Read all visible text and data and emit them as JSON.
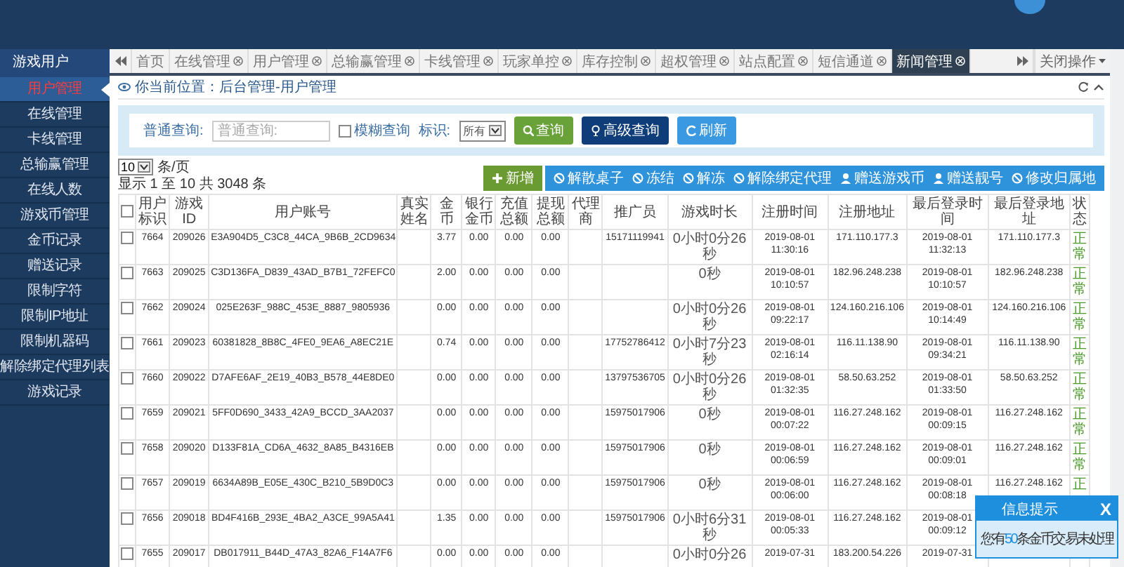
{
  "sidebar": {
    "title": "游戏用户",
    "items": [
      {
        "label": "用户管理",
        "selected": true
      },
      {
        "label": "在线管理",
        "selected": false
      },
      {
        "label": "卡线管理",
        "selected": false
      },
      {
        "label": "总输赢管理",
        "selected": false
      },
      {
        "label": "在线人数",
        "selected": false
      },
      {
        "label": "游戏币管理",
        "selected": false
      },
      {
        "label": "金币记录",
        "selected": false
      },
      {
        "label": "赠送记录",
        "selected": false
      },
      {
        "label": "限制字符",
        "selected": false
      },
      {
        "label": "限制IP地址",
        "selected": false
      },
      {
        "label": "限制机器码",
        "selected": false
      },
      {
        "label": "解除绑定代理列表",
        "selected": false
      },
      {
        "label": "游戏记录",
        "selected": false
      }
    ]
  },
  "tabs": {
    "items": [
      {
        "label": "首页",
        "closable": false,
        "selected": false
      },
      {
        "label": "在线管理",
        "closable": true,
        "selected": false
      },
      {
        "label": "用户管理",
        "closable": true,
        "selected": false
      },
      {
        "label": "总输赢管理",
        "closable": true,
        "selected": false
      },
      {
        "label": "卡线管理",
        "closable": true,
        "selected": false
      },
      {
        "label": "玩家单控",
        "closable": true,
        "selected": false
      },
      {
        "label": "库存控制",
        "closable": true,
        "selected": false
      },
      {
        "label": "超权管理",
        "closable": true,
        "selected": false
      },
      {
        "label": "站点配置",
        "closable": true,
        "selected": false
      },
      {
        "label": "短信通道",
        "closable": true,
        "selected": false
      },
      {
        "label": "新闻管理",
        "closable": true,
        "selected": true
      }
    ],
    "close_menu": "关闭操作"
  },
  "breadcrumb": "你当前位置：后台管理-用户管理",
  "search": {
    "label": "普通查询:",
    "placeholder": "普通查询:",
    "fuzzy": {
      "label": "模糊查询",
      "checked": false
    },
    "flag_label": "标识:",
    "flag_value": "所有",
    "buttons": [
      {
        "label": "查询",
        "kind": "search"
      },
      {
        "label": "高级查询",
        "kind": "advanced"
      },
      {
        "label": "刷新",
        "kind": "refresh"
      }
    ]
  },
  "paging": {
    "page_size": "10",
    "unit": "条/页",
    "summary": "显示 1 至 10 共 3048 条"
  },
  "actions": [
    {
      "label": "新增",
      "kind": "add"
    },
    {
      "label": "解散桌子",
      "kind": "ban"
    },
    {
      "label": "冻结",
      "kind": "ban"
    },
    {
      "label": "解冻",
      "kind": "ban"
    },
    {
      "label": "解除绑定代理",
      "kind": "ban"
    },
    {
      "label": "赠送游戏币",
      "kind": "user"
    },
    {
      "label": "赠送靓号",
      "kind": "user"
    },
    {
      "label": "修改归属地",
      "kind": "ban"
    }
  ],
  "table": {
    "select_all": false,
    "columns": [
      "用户标识",
      "游戏ID",
      "用户账号",
      "真实姓名",
      "金币",
      "银行金币",
      "充值总额",
      "提现总额",
      "代理商",
      "推广员",
      "游戏时长",
      "注册时间",
      "注册地址",
      "最后登录时间",
      "最后登录地址",
      "状态"
    ],
    "rows": [
      {
        "checked": false,
        "id": "7664",
        "game_id": "209026",
        "account": "E3A904D5_C3C8_44CA_9B6B_2CD9634",
        "gold": "3.77",
        "bank_gold": "0.00",
        "recharge_total": "0.00",
        "withdraw_total": "0.00",
        "promoter": "15171119941",
        "play_time": "0小时0分26秒",
        "reg_time": "2019-08-01 11:30:16",
        "reg_address": "171.110.177.3",
        "last_login_time": "2019-08-01 11:32:13",
        "last_login_address": "171.110.177.3",
        "status": "正常"
      },
      {
        "checked": false,
        "id": "7663",
        "game_id": "209025",
        "account": "C3D136FA_D839_43AD_B7B1_72FEFC0",
        "gold": "2.00",
        "bank_gold": "0.00",
        "recharge_total": "0.00",
        "withdraw_total": "0.00",
        "play_time": "0秒",
        "reg_time": "2019-08-01 10:10:57",
        "reg_address": "182.96.248.238",
        "last_login_time": "2019-08-01 10:10:57",
        "last_login_address": "182.96.248.238",
        "status": "正常"
      },
      {
        "checked": false,
        "id": "7662",
        "game_id": "209024",
        "account": "025E263F_988C_453E_8887_9805936",
        "gold": "0.00",
        "bank_gold": "0.00",
        "recharge_total": "0.00",
        "withdraw_total": "0.00",
        "play_time": "0小时0分26秒",
        "reg_time": "2019-08-01 09:22:17",
        "reg_address": "124.160.216.106",
        "last_login_time": "2019-08-01 10:14:49",
        "last_login_address": "124.160.216.106",
        "status": "正常"
      },
      {
        "checked": false,
        "id": "7661",
        "game_id": "209023",
        "account": "60381828_8B8C_4FE0_9EA6_A8EC21E",
        "gold": "0.74",
        "bank_gold": "0.00",
        "recharge_total": "0.00",
        "withdraw_total": "0.00",
        "promoter": "17752786412",
        "play_time": "0小时7分23秒",
        "reg_time": "2019-08-01 02:16:14",
        "reg_address": "116.11.138.90",
        "last_login_time": "2019-08-01 09:34:21",
        "last_login_address": "116.11.138.90",
        "status": "正常"
      },
      {
        "checked": false,
        "id": "7660",
        "game_id": "209022",
        "account": "D7AFE6AF_2E19_40B3_B578_44E8DE0",
        "gold": "0.00",
        "bank_gold": "0.00",
        "recharge_total": "0.00",
        "withdraw_total": "0.00",
        "promoter": "13797536705",
        "play_time": "0小时0分26秒",
        "reg_time": "2019-08-01 01:32:35",
        "reg_address": "58.50.63.252",
        "last_login_time": "2019-08-01 01:33:50",
        "last_login_address": "58.50.63.252",
        "status": "正常"
      },
      {
        "checked": false,
        "id": "7659",
        "game_id": "209021",
        "account": "5FF0D690_3433_42A9_BCCD_3AA2037",
        "gold": "0.00",
        "bank_gold": "0.00",
        "recharge_total": "0.00",
        "withdraw_total": "0.00",
        "promoter": "15975017906",
        "play_time": "0秒",
        "reg_time": "2019-08-01 00:07:22",
        "reg_address": "116.27.248.162",
        "last_login_time": "2019-08-01 00:09:15",
        "last_login_address": "116.27.248.162",
        "status": "正常"
      },
      {
        "checked": false,
        "id": "7658",
        "game_id": "209020",
        "account": "D133F81A_CD6A_4632_8A85_B4316EB",
        "gold": "0.00",
        "bank_gold": "0.00",
        "recharge_total": "0.00",
        "withdraw_total": "0.00",
        "promoter": "15975017906",
        "play_time": "0秒",
        "reg_time": "2019-08-01 00:06:59",
        "reg_address": "116.27.248.162",
        "last_login_time": "2019-08-01 00:09:01",
        "last_login_address": "116.27.248.162",
        "status": "正常"
      },
      {
        "checked": false,
        "id": "7657",
        "game_id": "209019",
        "account": "6634A89B_E05E_430C_B210_5B9D0C3",
        "gold": "0.00",
        "bank_gold": "0.00",
        "recharge_total": "0.00",
        "withdraw_total": "0.00",
        "promoter": "15975017906",
        "play_time": "0秒",
        "reg_time": "2019-08-01 00:06:00",
        "reg_address": "116.27.248.162",
        "last_login_time": "2019-08-01 00:08:18",
        "last_login_address": "116.27.248.162",
        "status": "正"
      },
      {
        "checked": false,
        "id": "7656",
        "game_id": "209018",
        "account": "BD4F416B_293E_4BA2_A3CE_99A5A41",
        "gold": "1.35",
        "bank_gold": "0.00",
        "recharge_total": "0.00",
        "withdraw_total": "0.00",
        "promoter": "15975017906",
        "play_time": "0小时6分31秒",
        "reg_time": "2019-08-01 00:05:33",
        "reg_address": "116.27.248.162",
        "last_login_time": "2019-08-01 00:09:12"
      },
      {
        "checked": false,
        "id": "7655",
        "game_id": "209017",
        "account": "DB017911_B44D_47A3_82A6_F14A7F6",
        "gold": "0.00",
        "bank_gold": "0.00",
        "recharge_total": "0.00",
        "withdraw_total": "0.00",
        "play_time": "0小时0分26",
        "reg_time": "2019-07-31",
        "reg_address": "183.200.54.226",
        "last_login_time": "2019-07-31"
      }
    ]
  },
  "notice": {
    "title": "信息提示",
    "close": "X",
    "before": "您有",
    "count": "50",
    "after": "条金币交易未处理"
  }
}
